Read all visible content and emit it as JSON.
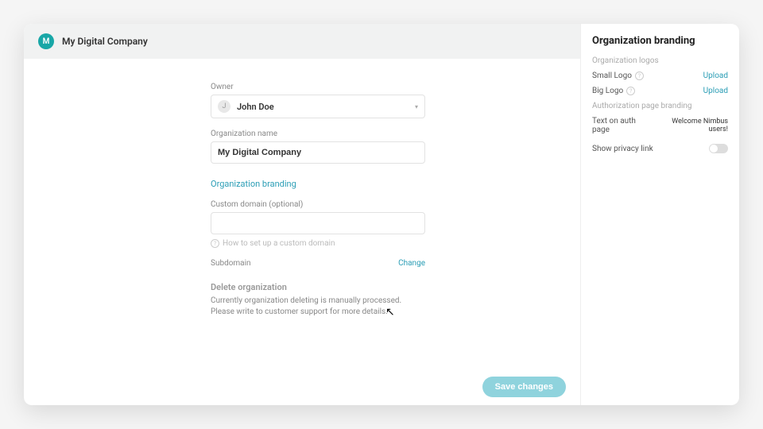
{
  "header": {
    "avatar_letter": "M",
    "title": "My Digital Company"
  },
  "form": {
    "owner_label": "Owner",
    "owner_avatar_letter": "J",
    "owner_name": "John Doe",
    "org_name_label": "Organization name",
    "org_name_value": "My Digital Company",
    "branding_link": "Organization branding",
    "custom_domain_label": "Custom domain (optional)",
    "custom_domain_value": "",
    "custom_domain_help": "How to set up a custom domain",
    "subdomain_label": "Subdomain",
    "change_label": "Change",
    "delete_heading": "Delete organization",
    "delete_text_1": "Currently organization deleting is manually processed.",
    "delete_text_2": "Please write to customer support for more details.",
    "save_label": "Save changes"
  },
  "sidebar": {
    "title": "Organization branding",
    "logos_section": "Organization logos",
    "small_logo_label": "Small Logo",
    "big_logo_label": "Big Logo",
    "upload_label": "Upload",
    "auth_section": "Authorization page branding",
    "text_on_auth_label": "Text on auth page",
    "text_on_auth_value": "Welcome Nimbus users!",
    "privacy_label": "Show privacy link"
  }
}
